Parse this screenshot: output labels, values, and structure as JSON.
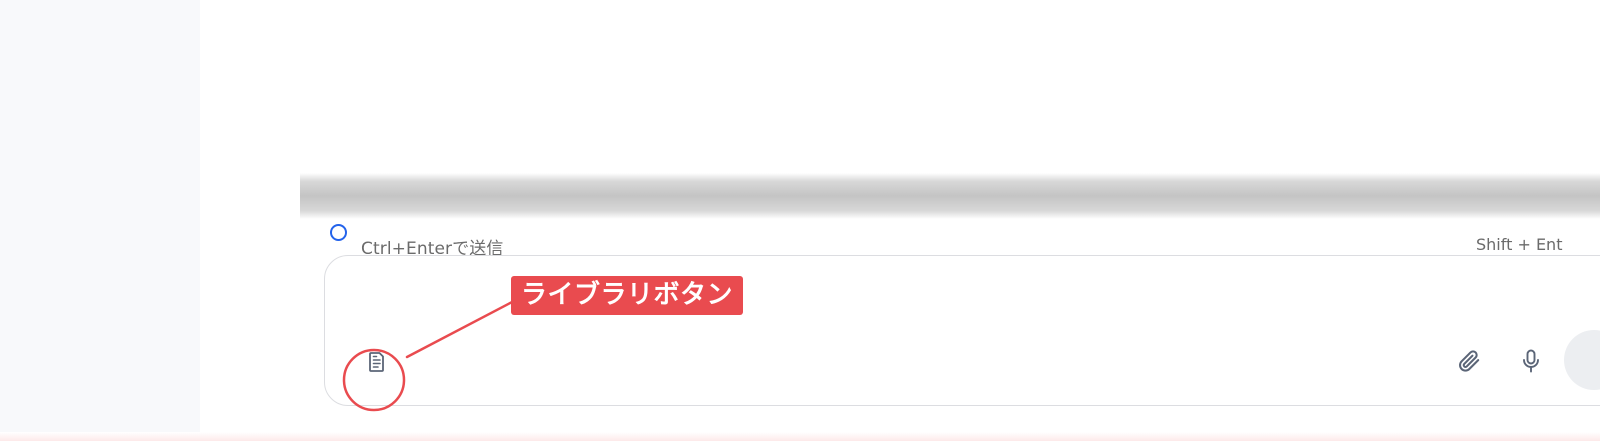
{
  "composer": {
    "hint_left": "Ctrl+Enterで送信",
    "hint_right": "Shift + Ent"
  },
  "annotation": {
    "label": "ライブラリボタン",
    "color": "#e94b4f"
  },
  "icons": {
    "library": "document-icon",
    "attach": "paperclip-icon",
    "mic": "microphone-icon"
  },
  "colors": {
    "accent": "#2463eb",
    "icon": "#5b6577",
    "hint_text": "#6b6b6b"
  }
}
